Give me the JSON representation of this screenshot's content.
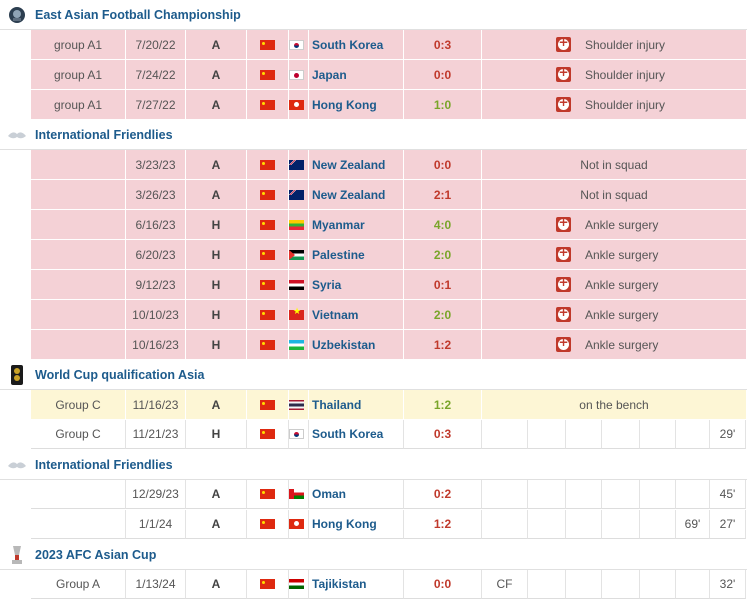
{
  "sections": [
    {
      "title": "East Asian Football Championship",
      "icon": "eaff-icon",
      "rows": [
        {
          "comp": "group A1",
          "date": "7/20/22",
          "ha": "A",
          "team": "South Korea",
          "flag": "kr",
          "score": "0:3",
          "result": "loss",
          "note": "Shoulder injury",
          "injury": true,
          "style": "red"
        },
        {
          "comp": "group A1",
          "date": "7/24/22",
          "ha": "A",
          "team": "Japan",
          "flag": "jp",
          "score": "0:0",
          "result": "draw",
          "note": "Shoulder injury",
          "injury": true,
          "style": "red"
        },
        {
          "comp": "group A1",
          "date": "7/27/22",
          "ha": "A",
          "team": "Hong Kong",
          "flag": "hk",
          "score": "1:0",
          "result": "win",
          "note": "Shoulder injury",
          "injury": true,
          "style": "red"
        }
      ]
    },
    {
      "title": "International Friendlies",
      "icon": "friendlies-icon",
      "rows": [
        {
          "comp": "",
          "date": "3/23/23",
          "ha": "A",
          "team": "New Zealand",
          "flag": "nz",
          "score": "0:0",
          "result": "draw",
          "note": "Not in squad",
          "injury": false,
          "style": "red"
        },
        {
          "comp": "",
          "date": "3/26/23",
          "ha": "A",
          "team": "New Zealand",
          "flag": "nz",
          "score": "2:1",
          "result": "loss",
          "note": "Not in squad",
          "injury": false,
          "style": "red"
        },
        {
          "comp": "",
          "date": "6/16/23",
          "ha": "H",
          "team": "Myanmar",
          "flag": "mm",
          "score": "4:0",
          "result": "win",
          "note": "Ankle surgery",
          "injury": true,
          "style": "red"
        },
        {
          "comp": "",
          "date": "6/20/23",
          "ha": "H",
          "team": "Palestine",
          "flag": "ps",
          "score": "2:0",
          "result": "win",
          "note": "Ankle surgery",
          "injury": true,
          "style": "red"
        },
        {
          "comp": "",
          "date": "9/12/23",
          "ha": "H",
          "team": "Syria",
          "flag": "sy",
          "score": "0:1",
          "result": "loss",
          "note": "Ankle surgery",
          "injury": true,
          "style": "red"
        },
        {
          "comp": "",
          "date": "10/10/23",
          "ha": "H",
          "team": "Vietnam",
          "flag": "vn",
          "score": "2:0",
          "result": "win",
          "note": "Ankle surgery",
          "injury": true,
          "style": "red"
        },
        {
          "comp": "",
          "date": "10/16/23",
          "ha": "H",
          "team": "Uzbekistan",
          "flag": "uz",
          "score": "1:2",
          "result": "loss",
          "note": "Ankle surgery",
          "injury": true,
          "style": "red"
        }
      ]
    },
    {
      "title": "World Cup qualification Asia",
      "icon": "world-cup-icon",
      "rows": [
        {
          "comp": "Group C",
          "date": "11/16/23",
          "ha": "A",
          "team": "Thailand",
          "flag": "th",
          "score": "1:2",
          "result": "win",
          "note": "on the bench",
          "injury": false,
          "style": "yel"
        },
        {
          "comp": "Group C",
          "date": "11/21/23",
          "ha": "H",
          "team": "South Korea",
          "flag": "kr",
          "score": "0:3",
          "result": "loss",
          "style": "wht",
          "pos": "",
          "s": [
            "",
            "",
            "",
            "",
            "",
            ""
          ],
          "min": "29'"
        }
      ]
    },
    {
      "title": "International Friendlies",
      "icon": "friendlies-icon",
      "rows": [
        {
          "comp": "",
          "date": "12/29/23",
          "ha": "A",
          "team": "Oman",
          "flag": "om",
          "score": "0:2",
          "result": "loss",
          "style": "wht",
          "pos": "",
          "s": [
            "",
            "",
            "",
            "",
            "",
            ""
          ],
          "min": "45'"
        },
        {
          "comp": "",
          "date": "1/1/24",
          "ha": "A",
          "team": "Hong Kong",
          "flag": "hk",
          "score": "1:2",
          "result": "loss",
          "style": "wht",
          "pos": "",
          "s": [
            "",
            "",
            "",
            "",
            "69'",
            ""
          ],
          "min": "27'"
        }
      ]
    },
    {
      "title": "2023 AFC Asian Cup",
      "icon": "asian-cup-icon",
      "rows": [
        {
          "comp": "Group A",
          "date": "1/13/24",
          "ha": "A",
          "team": "Tajikistan",
          "flag": "tj",
          "score": "0:0",
          "result": "draw",
          "style": "wht",
          "pos": "CF",
          "s": [
            "",
            "",
            "",
            "",
            "",
            ""
          ],
          "min": "32'"
        }
      ]
    }
  ],
  "colors": {
    "unavailable_row": "#f4d1d6",
    "bench_row": "#fdf6d5",
    "link": "#1d5b8c",
    "loss": "#c0392b",
    "win": "#7aa52a"
  }
}
